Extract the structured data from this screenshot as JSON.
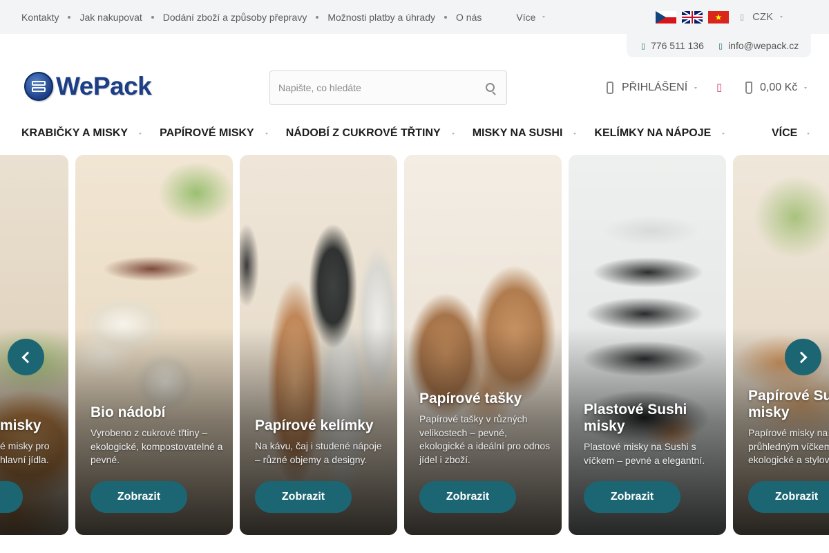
{
  "topnav": {
    "items": [
      "Kontakty",
      "Jak nakupovat",
      "Dodání zboží a způsoby přepravy",
      "Možnosti platby a úhrady",
      "O nás"
    ],
    "more_label": "Více"
  },
  "languages": [
    "cz-flag-icon",
    "uk-flag-icon",
    "vn-flag-icon"
  ],
  "currency": {
    "label": "CZK"
  },
  "contact": {
    "phone": "776 511 136",
    "email": "info@wepack.cz"
  },
  "header": {
    "logo_text": "WePack",
    "search_placeholder": "Napište, co hledáte",
    "login_label": "PŘIHLÁŠENÍ",
    "cart_total": "0,00 Kč"
  },
  "mainnav": {
    "items": [
      "KRABIČKY A MISKY",
      "PAPÍROVÉ MISKY",
      "NÁDOBÍ Z CUKROVÉ TŘTINY",
      "MISKY NA SUSHI",
      "KELÍMKY NA NÁPOJE"
    ],
    "more_label": "VÍCE"
  },
  "carousel": {
    "cards": [
      {
        "title": "misky",
        "desc": "é misky pro hlavní jídla.",
        "button": ""
      },
      {
        "title": "Bio nádobí",
        "desc": "Vyrobeno z cukrové třtiny – ekologické, kompostovatelné a pevné.",
        "button": "Zobrazit"
      },
      {
        "title": "Papírové kelímky",
        "desc": "Na kávu, čaj i studené nápoje – různé objemy a designy.",
        "button": "Zobrazit"
      },
      {
        "title": "Papírové tašky",
        "desc": "Papírové tašky v různých velikostech – pevné, ekologické a ideální pro odnos jídel i zboží.",
        "button": "Zobrazit"
      },
      {
        "title": "Plastové Sushi misky",
        "desc": "Plastové misky na Sushi s víčkem – pevné a elegantní.",
        "button": "Zobrazit"
      },
      {
        "title": "Papírové Sushi misky",
        "desc": "Papírové misky na Sushi s průhledným víčkem – ekologické a stylové.",
        "button": "Zobrazit"
      }
    ]
  },
  "colors": {
    "accent": "#1c6674",
    "topbar": "#f3f4f5",
    "brand": "#1b3e86",
    "heart": "#d23c75"
  }
}
